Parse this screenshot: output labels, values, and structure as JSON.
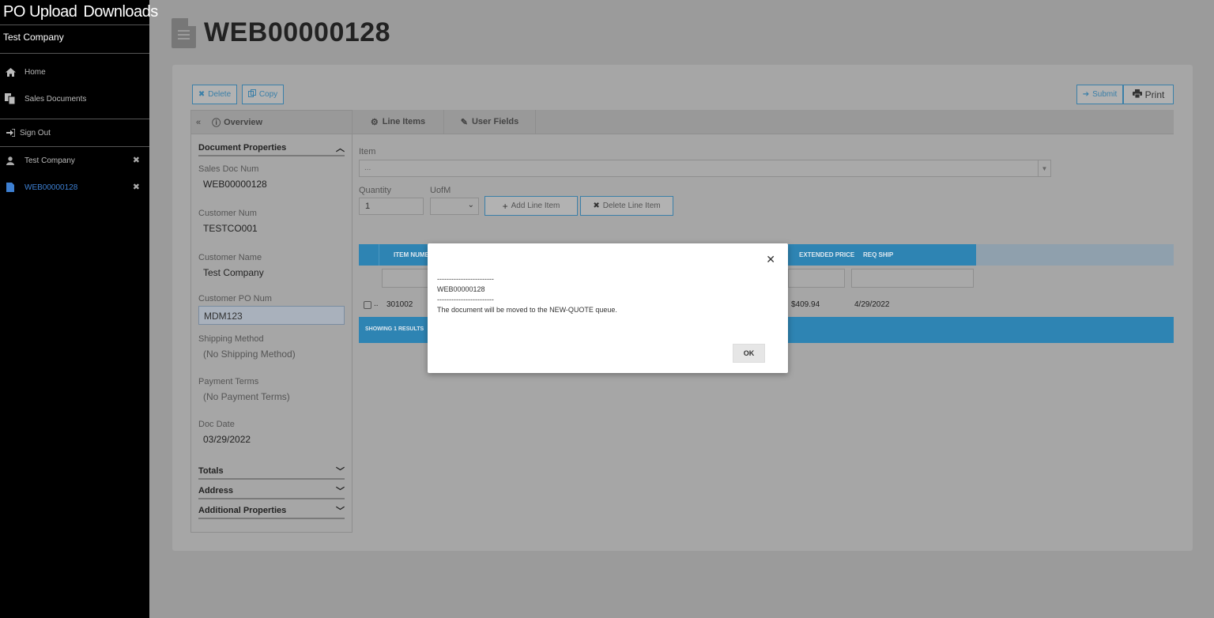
{
  "sidebar": {
    "brand": [
      "PO Upload",
      "Downloads"
    ],
    "company": "Test Company",
    "nav": [
      {
        "label": "Home",
        "icon": "home-icon"
      },
      {
        "label": "Sales Documents",
        "icon": "documents-icon"
      }
    ],
    "sign_out": "Sign Out",
    "open_items": [
      {
        "label": "Test Company",
        "icon": "user-icon"
      },
      {
        "label": "WEB00000128",
        "icon": "file-icon"
      }
    ]
  },
  "header": {
    "title": "WEB00000128"
  },
  "toolbar": {
    "delete": "Delete",
    "copy": "Copy",
    "submit": "Submit",
    "print": "Print"
  },
  "overview": {
    "title": "Overview",
    "section_document_properties": "Document Properties",
    "fields": [
      {
        "label": "Sales Doc Num",
        "value": "WEB00000128"
      },
      {
        "label": "Customer Num",
        "value": "TESTCO001"
      },
      {
        "label": "Customer Name",
        "value": "Test Company"
      },
      {
        "label": "Customer PO Num",
        "value": "MDM123"
      },
      {
        "label": "Shipping Method",
        "value": "(No Shipping Method)"
      },
      {
        "label": "Payment Terms",
        "value": "(No Payment Terms)"
      },
      {
        "label": "Doc Date",
        "value": "03/29/2022"
      }
    ],
    "sections": [
      "Totals",
      "Address",
      "Additional Properties"
    ]
  },
  "tabs": [
    {
      "label": "Line Items"
    },
    {
      "label": "User Fields"
    }
  ],
  "line_items_form": {
    "item_label": "Item",
    "item_value": "...",
    "quantity_label": "Quantity",
    "quantity_value": "1",
    "uofm_label": "UofM",
    "add_button": "Add Line Item",
    "delete_button": "Delete Line Item"
  },
  "grid": {
    "headers": {
      "item_number": "ITEM NUMB",
      "extended_price": "EXTENDED PRICE",
      "req_ship": "REQ SHIP"
    },
    "rows": [
      {
        "item_number": "301002",
        "extended_price": "$409.94",
        "req_ship": "4/29/2022"
      }
    ],
    "footer": "SHOWING 1 RESULTS"
  },
  "modal": {
    "separator": "------------------------",
    "doc": "WEB00000128",
    "message": "The document will be moved to the NEW-QUOTE queue.",
    "ok": "OK"
  },
  "colors": {
    "accent": "#2e84b3",
    "sidebar_bg": "#000000",
    "active_link": "#3d7fd1"
  }
}
